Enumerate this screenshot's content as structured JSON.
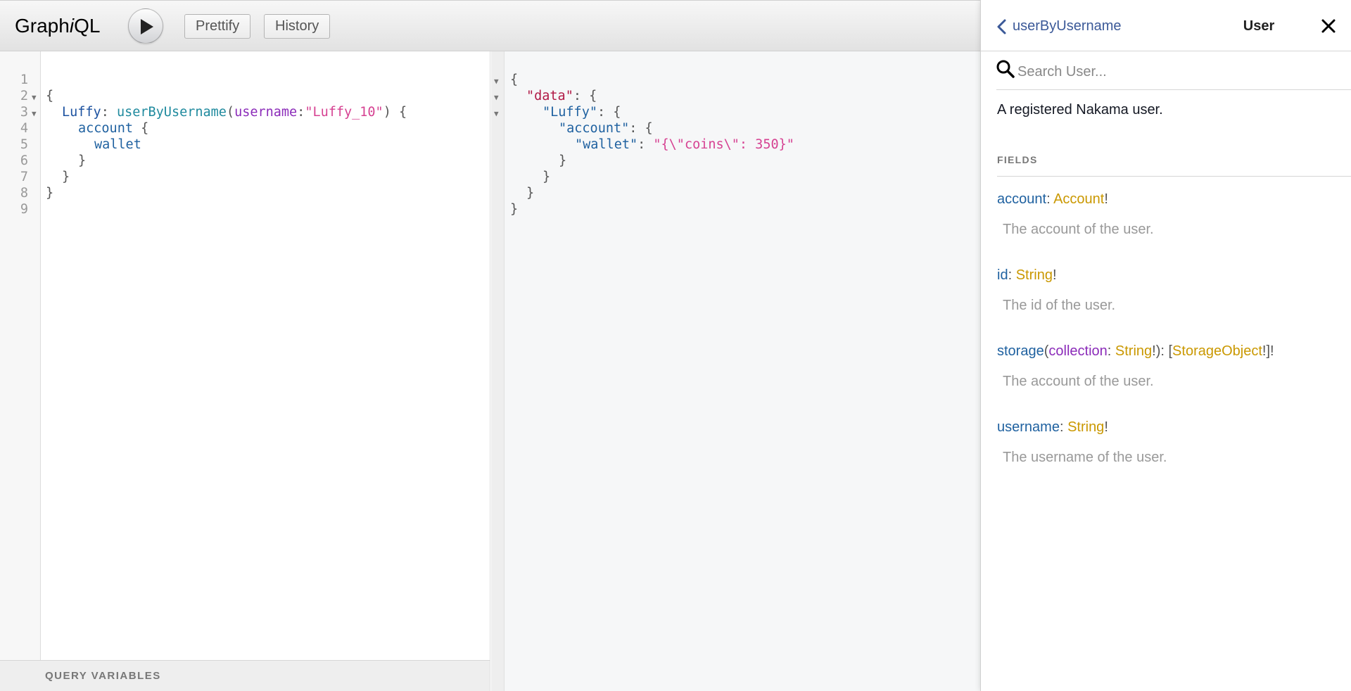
{
  "topbar": {
    "logo_prefix": "Graph",
    "logo_italic": "i",
    "logo_suffix": "QL",
    "prettify_label": "Prettify",
    "history_label": "History"
  },
  "query_editor": {
    "line_numbers": [
      "1",
      "2",
      "3",
      "4",
      "5",
      "6",
      "7",
      "8",
      "9"
    ],
    "tokens": {
      "open_brace": "{",
      "alias": "Luffy",
      "colon": ": ",
      "field": "userByUsername",
      "paren_open": "(",
      "arg_name": "username",
      "arg_colon": ":",
      "arg_value": "\"Luffy_10\"",
      "paren_close": ") {",
      "account": "account",
      "account_brace": " {",
      "wallet": "wallet",
      "close_brace": "}"
    },
    "variables_title": "QUERY VARIABLES"
  },
  "result": {
    "open_brace": "{",
    "data_key": "\"data\"",
    "luffy_key": "\"Luffy\"",
    "account_key": "\"account\"",
    "wallet_key": "\"wallet\"",
    "wallet_value": "\"{\\\"coins\\\": 350}\"",
    "colon_brace": ": {",
    "colon": ": ",
    "close_brace": "}"
  },
  "doc_explorer": {
    "back_label": "userByUsername",
    "title": "User",
    "search_placeholder": "Search User...",
    "description": "A registered Nakama user.",
    "fields_title": "FIELDS",
    "fields": [
      {
        "name": "account",
        "type": "Account",
        "description": "The account of the user."
      },
      {
        "name": "id",
        "type": "String",
        "description": "The id of the user."
      },
      {
        "name": "storage",
        "arg_name": "collection",
        "arg_type": "String",
        "type": "StorageObject",
        "description": "The account of the user."
      },
      {
        "name": "username",
        "type": "String",
        "description": "The username of the user."
      }
    ]
  }
}
